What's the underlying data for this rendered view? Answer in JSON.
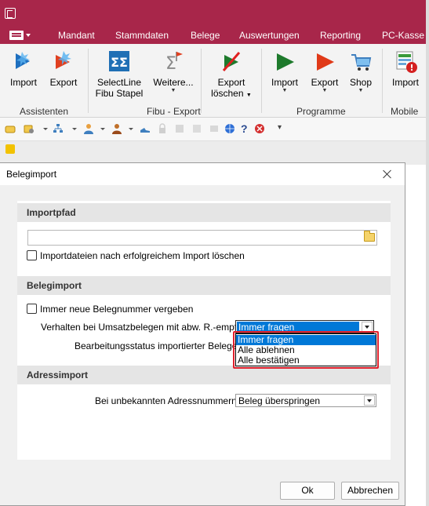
{
  "menu": {
    "tabs": [
      "Mandant",
      "Stammdaten",
      "Belege",
      "Auswertungen",
      "Reporting",
      "PC-Kasse"
    ]
  },
  "ribbon": {
    "groups": {
      "assistenten": "Assistenten",
      "fibu_export": "Fibu - Export",
      "programme": "Programme",
      "mobile": "Mobile"
    },
    "buttons": {
      "import1": "Import",
      "export1": "Export",
      "selectline_line1": "SelectLine",
      "selectline_line2": "Fibu Stapel",
      "weitere": "Weitere...",
      "export_loeschen_line1": "Export",
      "export_loeschen_line2": "löschen",
      "import2": "Import",
      "export2": "Export",
      "shop": "Shop",
      "import3": "Import"
    },
    "drop_glyph": "▼"
  },
  "qat": {
    "help_glyph": "?",
    "more_glyph": "▾"
  },
  "dialog": {
    "title": "Belegimport",
    "sections": {
      "importpfad": "Importpfad",
      "belegimport": "Belegimport",
      "adressimport": "Adressimport"
    },
    "importpfad": {
      "path_value": "",
      "delete_after_import_label": "Importdateien nach erfolgreichem Import löschen",
      "delete_after_import_checked": false
    },
    "belegimport": {
      "new_number_label": "Immer neue Belegnummer vergeben",
      "new_number_checked": false,
      "umsatz_label": "Verhalten bei Umsatzbelegen mit abw. R.-empf.",
      "umsatz_value": "Immer fragen",
      "status_label": "Bearbeitungsstatus importierter Belege"
    },
    "dropdown_options": [
      "Immer fragen",
      "Alle ablehnen",
      "Alle bestätigen"
    ],
    "dropdown_selected_index": 0,
    "adressimport": {
      "unknown_label": "Bei unbekannten Adressnummern",
      "unknown_value": "Beleg überspringen"
    },
    "buttons": {
      "ok": "Ok",
      "cancel": "Abbrechen"
    }
  },
  "colors": {
    "brand": "#a8264a",
    "selection": "#0078d7",
    "highlight": "#e0202c"
  }
}
